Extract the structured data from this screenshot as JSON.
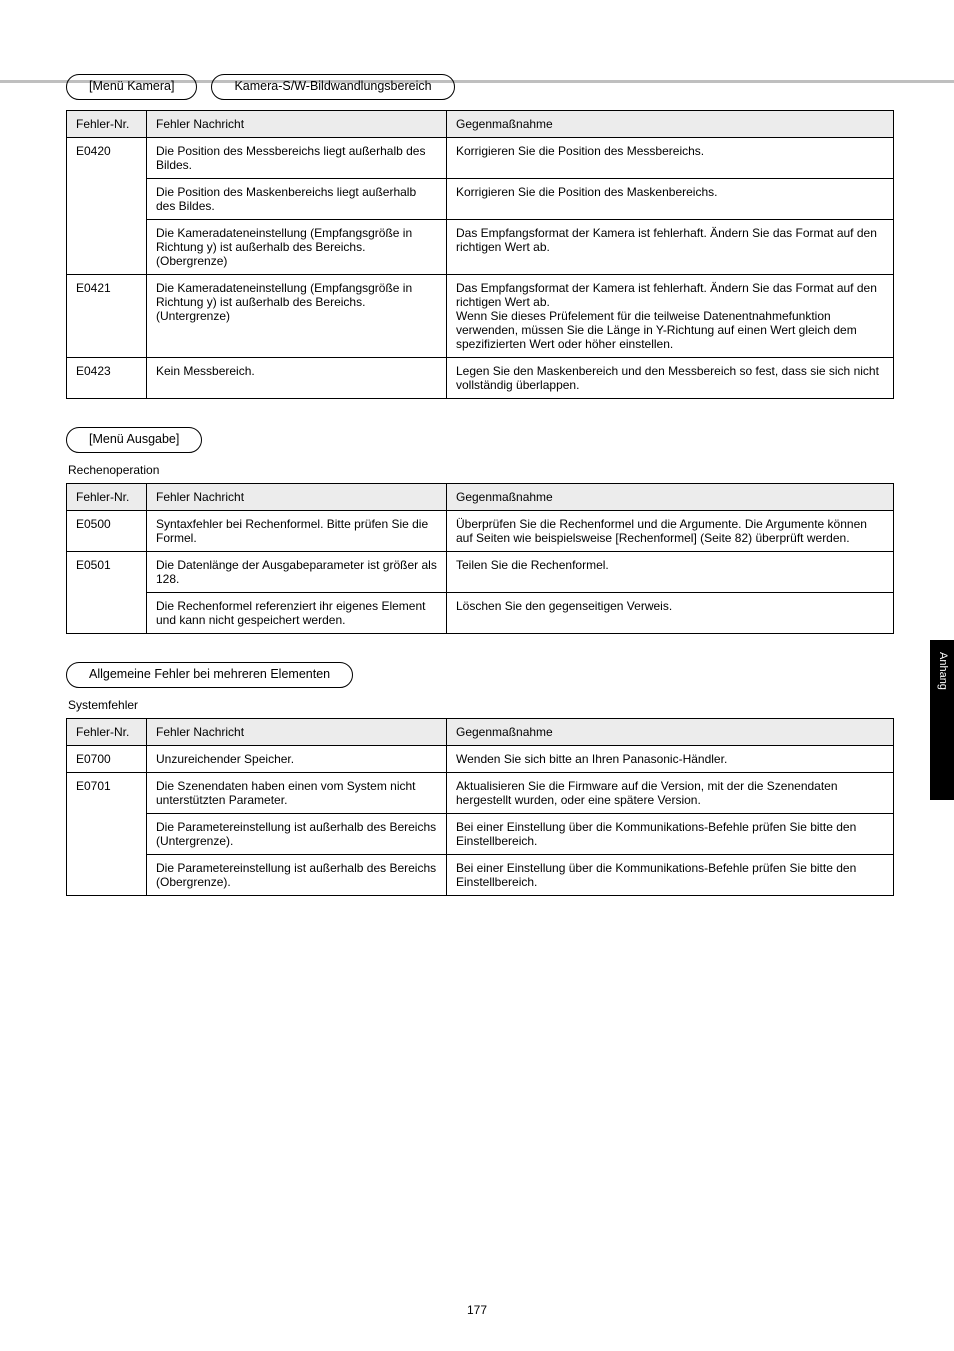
{
  "sidebar_label": "Anhang",
  "page_number": "177",
  "sections": [
    {
      "chips": [
        "[Menü Kamera]",
        "Kamera-S/W-Bildwandlungsbereich"
      ],
      "intro": null,
      "headers": [
        "Fehler-Nr.",
        "Fehler Nachricht",
        "Gegenmaßnahme"
      ],
      "rows": [
        {
          "no": "E0420",
          "rowspan": 3,
          "msg": "Die Position des Messbereichs liegt außerhalb des Bildes.",
          "fix": "Korrigieren Sie die Position des Messbereichs."
        },
        {
          "no": "",
          "msg": "Die Position des Maskenbereichs liegt außerhalb des Bildes.",
          "fix": "Korrigieren Sie die Position des Maskenbereichs."
        },
        {
          "no": "",
          "msg": "Die Kameradateneinstellung (Empfangsgröße in Richtung y) ist außerhalb des Bereichs. (Obergrenze)",
          "fix": "Das Empfangsformat der Kamera ist fehlerhaft. Ändern Sie das Format auf den richtigen Wert ab."
        },
        {
          "no": "E0421",
          "rowspan": 1,
          "msg": "Die Kameradateneinstellung (Empfangsgröße in Richtung y) ist außerhalb des Bereichs. (Untergrenze)",
          "fix": "Das Empfangsformat der Kamera ist fehlerhaft. Ändern Sie das Format auf den richtigen Wert ab.\nWenn Sie dieses Prüfelement für die teilweise Datenentnahmefunktion verwenden, müssen Sie die Länge in Y-Richtung auf einen Wert gleich dem spezifizierten Wert oder höher einstellen."
        },
        {
          "no": "E0423",
          "rowspan": 1,
          "msg": "Kein Messbereich.",
          "fix": "Legen Sie den Maskenbereich und den Messbereich so fest, dass sie sich nicht vollständig überlappen."
        }
      ]
    },
    {
      "chips": [
        "[Menü Ausgabe]"
      ],
      "intro": "Rechenoperation",
      "headers": [
        "Fehler-Nr.",
        "Fehler Nachricht",
        "Gegenmaßnahme"
      ],
      "rows": [
        {
          "no": "E0500",
          "rowspan": 1,
          "msg": "Syntaxfehler bei Rechenformel. Bitte prüfen Sie die Formel.",
          "fix": "Überprüfen Sie die Rechenformel und die Argumente. Die Argumente können auf Seiten wie beispielsweise [Rechenformel] (Seite 82) überprüft werden."
        },
        {
          "no": "E0501",
          "rowspan": 2,
          "msg": "Die Datenlänge der Ausgabeparameter ist größer als 128.",
          "fix": "Teilen Sie die Rechenformel."
        },
        {
          "no": "",
          "msg": "Die Rechenformel referenziert ihr eigenes Element und kann nicht gespeichert werden.",
          "fix": "Löschen Sie den gegenseitigen Verweis."
        }
      ]
    },
    {
      "chips": [
        "Allgemeine Fehler bei mehreren Elementen"
      ],
      "intro": "Systemfehler",
      "headers": [
        "Fehler-Nr.",
        "Fehler Nachricht",
        "Gegenmaßnahme"
      ],
      "rows": [
        {
          "no": "E0700",
          "rowspan": 1,
          "msg": "Unzureichender Speicher.",
          "fix": "Wenden Sie sich bitte an Ihren Panasonic-Händler."
        },
        {
          "no": "E0701",
          "rowspan": 3,
          "msg": "Die Szenendaten haben einen vom System nicht unterstützten Parameter.",
          "fix": "Aktualisieren Sie die Firmware auf die Version, mit der die Szenendaten hergestellt wurden, oder eine spätere Version."
        },
        {
          "no": "",
          "msg": "Die Parametereinstellung ist außerhalb des Bereichs (Untergrenze).",
          "fix": "Bei einer Einstellung über die Kommunikations-Befehle prüfen Sie bitte den Einstellbereich."
        },
        {
          "no": "",
          "msg": "Die Parametereinstellung ist außerhalb des Bereichs (Obergrenze).",
          "fix": "Bei einer Einstellung über die Kommunikations-Befehle prüfen Sie bitte den Einstellbereich."
        }
      ]
    }
  ]
}
